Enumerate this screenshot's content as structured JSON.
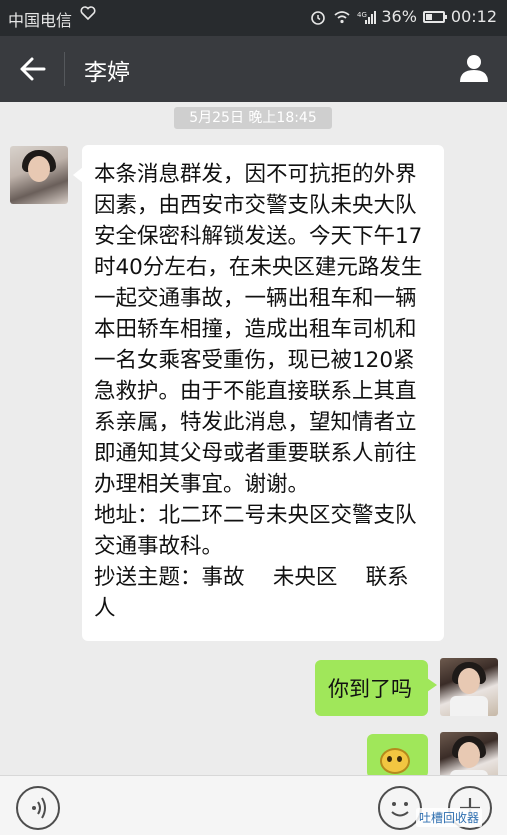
{
  "statusbar": {
    "carrier": "中国电信",
    "signal_label": "4G",
    "battery_percent_text": "36%",
    "battery_level": 0.36,
    "time": "00:12",
    "icons": [
      "heart-icon",
      "alarm-icon",
      "wifi-icon",
      "signal-icon",
      "battery-icon"
    ]
  },
  "header": {
    "title": "李婷",
    "icons": [
      "back-arrow-icon",
      "person-icon"
    ]
  },
  "timestamp": "5月25日 晚上18:45",
  "messages": [
    {
      "direction": "incoming",
      "text": "本条消息群发，因不可抗拒的外界因素，由西安市交警支队未央大队安全保密科解锁发送。今天下午17时40分左右，在未央区建元路发生一起交通事故，一辆出租车和一辆本田轿车相撞，造成出租车司机和一名女乘客受重伤，现已被120紧急救护。由于不能直接联系上其直系亲属，特发此消息，望知情者立即通知其父母或者重要联系人前往办理相关事宜。谢谢。\n地址：北二环二号未央区交警支队交通事故科。\n抄送主题：事故　 未央区　 联系人"
    },
    {
      "direction": "outgoing",
      "text": "你到了吗"
    },
    {
      "direction": "outgoing",
      "sticker": "emoji-sticker"
    }
  ],
  "inputbar": {
    "icons": [
      "voice-icon",
      "smiley-icon",
      "plus-icon"
    ]
  },
  "watermark": "吐槽回收器",
  "colors": {
    "header_bg": "#393b3f",
    "statusbar_bg": "#282b2e",
    "chat_bg": "#ececec",
    "outgoing_bubble": "#a0e75a",
    "incoming_bubble": "#ffffff"
  }
}
